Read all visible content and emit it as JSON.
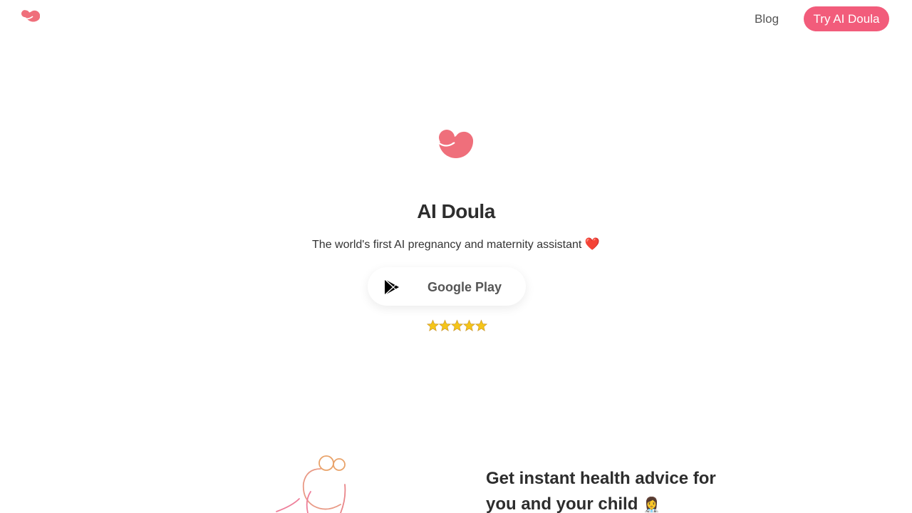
{
  "header": {
    "logo_icon": "brand-logo-icon",
    "blog_label": "Blog",
    "cta_label": "Try AI Doula"
  },
  "hero": {
    "logo_icon": "brand-logo-icon",
    "title": "AI Doula",
    "subtitle": "The world's first AI pregnancy and maternity assistant",
    "subtitle_emoji": "❤️",
    "store_button": {
      "icon": "google-play-icon",
      "label": "Google Play"
    },
    "rating": {
      "stars": 5,
      "max": 5
    }
  },
  "feature": {
    "title": "Get instant health advice for you and your child",
    "title_emoji": "👩‍⚕️",
    "illustration": "line-art-illustration"
  },
  "colors": {
    "brand": "#f25c7b",
    "logo": "#ef6f7b",
    "text": "#2d2d2d",
    "muted": "#555555",
    "star": "#f5c518"
  }
}
